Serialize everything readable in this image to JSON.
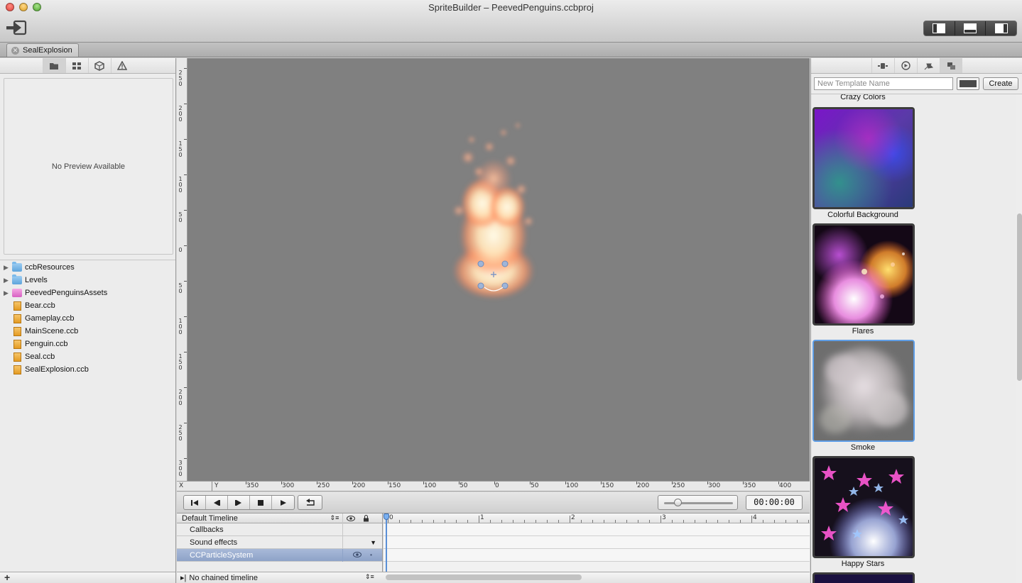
{
  "window": {
    "title": "SpriteBuilder – PeevedPenguins.ccbproj"
  },
  "toolbar": {
    "publish_icon": "publish-icon",
    "layout_icons": [
      "layout-left-panel-icon",
      "layout-bottom-panel-icon",
      "layout-right-panel-icon"
    ]
  },
  "tabs": [
    {
      "label": "SealExplosion",
      "close_icon": "close-icon"
    }
  ],
  "left_panel": {
    "toolbar_icons": [
      "folder-icon",
      "grid-icon",
      "cube-icon",
      "warning-icon"
    ],
    "preview_text": "No Preview Available",
    "tree": [
      {
        "label": "ccbResources",
        "type": "folder"
      },
      {
        "label": "Levels",
        "type": "folder"
      },
      {
        "label": "PeevedPenguinsAssets",
        "type": "assets"
      },
      {
        "label": "Bear.ccb",
        "type": "file"
      },
      {
        "label": "Gameplay.ccb",
        "type": "file"
      },
      {
        "label": "MainScene.ccb",
        "type": "file"
      },
      {
        "label": "Penguin.ccb",
        "type": "file"
      },
      {
        "label": "Seal.ccb",
        "type": "file"
      },
      {
        "label": "SealExplosion.ccb",
        "type": "file"
      }
    ],
    "add_label": "+"
  },
  "rulers": {
    "x_axis_label": "X",
    "y_axis_label": "Y",
    "x_ticks": [
      "350",
      "300",
      "250",
      "200",
      "150",
      "100",
      "50",
      "0",
      "50",
      "100",
      "150",
      "200",
      "250",
      "300",
      "350",
      "400"
    ],
    "y_ticks": [
      "250",
      "200",
      "150",
      "100",
      "50",
      "0",
      "50",
      "100",
      "150",
      "200",
      "250",
      "300"
    ]
  },
  "transport": {
    "buttons": [
      "jump-start-icon",
      "step-back-icon",
      "step-forward-icon",
      "stop-icon",
      "play-icon"
    ],
    "loop_icon": "loop-icon",
    "zoom_level": 0.2,
    "timecode": "00:00:00"
  },
  "timeline": {
    "header": "Default Timeline",
    "rows": [
      {
        "label": "Callbacks"
      },
      {
        "label": "Sound effects"
      },
      {
        "label": "CCParticleSystem",
        "selected": true
      }
    ],
    "scale_labels": [
      "0",
      "1",
      "2",
      "3",
      "4"
    ],
    "chain_label": "No chained timeline"
  },
  "right_panel": {
    "toolbar_icons": [
      "properties-icon",
      "code-icon",
      "pin-icon",
      "templates-icon"
    ],
    "template_placeholder": "New Template Name",
    "color_well": "#4a4a4a",
    "create_label": "Create",
    "top_caption": "Crazy Colors",
    "templates": [
      {
        "label": "Colorful Background",
        "selected": false
      },
      {
        "label": "Flares",
        "selected": false
      },
      {
        "label": "Smoke",
        "selected": true
      },
      {
        "label": "Happy Stars",
        "selected": false
      }
    ]
  },
  "colors": {
    "canvas_background": "#808080",
    "selection": "#5f9ee6"
  }
}
